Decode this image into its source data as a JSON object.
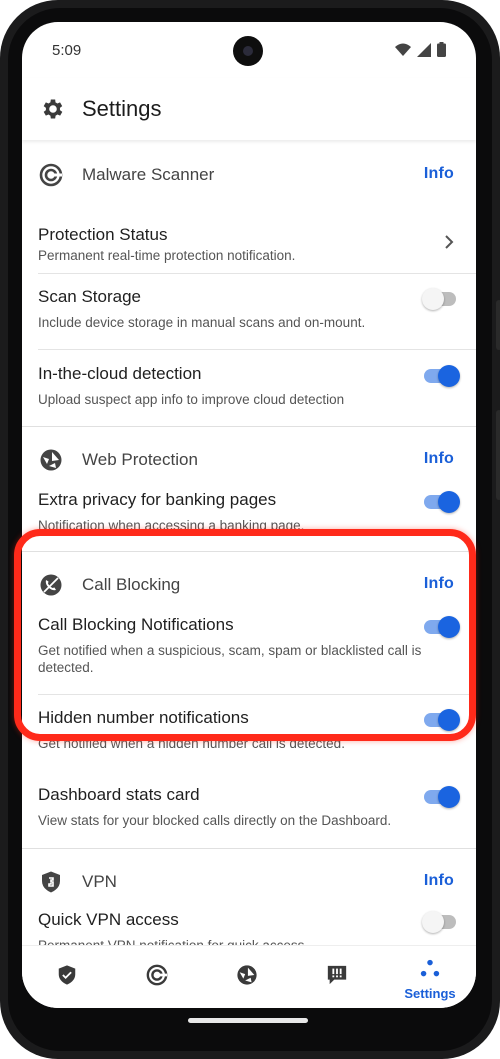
{
  "status": {
    "time": "5:09"
  },
  "app": {
    "title": "Settings"
  },
  "sections": [
    {
      "title": "Malware Scanner",
      "info": "Info",
      "icon": "malware-scanner-icon",
      "rows": [
        {
          "title": "Protection Status",
          "subtitle": "Permanent real-time protection notification.",
          "control": "chevron"
        },
        {
          "title": "Scan Storage",
          "subtitle": "Include device storage in manual scans and on-mount.",
          "control": "toggle",
          "on": false
        },
        {
          "title": "In-the-cloud detection",
          "subtitle": "Upload suspect app info to improve cloud detection",
          "control": "toggle",
          "on": true
        }
      ]
    },
    {
      "title": "Web Protection",
      "info": "Info",
      "icon": "web-protection-icon",
      "rows": [
        {
          "title": "Extra privacy for banking pages",
          "subtitle": "Notification when accessing a banking page.",
          "control": "toggle",
          "on": true
        }
      ]
    },
    {
      "title": "Call Blocking",
      "info": "Info",
      "icon": "call-blocking-icon",
      "rows": [
        {
          "title": "Call Blocking Notifications",
          "subtitle": "Get notified when a suspicious, scam, spam or blacklisted call is detected.",
          "control": "toggle",
          "on": true
        },
        {
          "title": "Hidden number notifications",
          "subtitle": "Get notified when a hidden number call is detected.",
          "control": "toggle",
          "on": true
        },
        {
          "title": "Dashboard stats card",
          "subtitle": "View stats for your blocked calls directly on the Dashboard.",
          "control": "toggle",
          "on": true
        }
      ]
    },
    {
      "title": "VPN",
      "info": "Info",
      "icon": "vpn-shield-icon",
      "rows": [
        {
          "title": "Quick VPN access",
          "subtitle": "Permanent VPN notification for quick access.",
          "control": "toggle",
          "on": false
        }
      ]
    }
  ],
  "bottom_nav": [
    {
      "icon": "shield-check-icon",
      "label": ""
    },
    {
      "icon": "scanner-icon",
      "label": ""
    },
    {
      "icon": "web-icon",
      "label": ""
    },
    {
      "icon": "message-alert-icon",
      "label": ""
    },
    {
      "icon": "settings-dots-icon",
      "label": "Settings",
      "active": true
    }
  ],
  "colors": {
    "accent": "#1a5fd8",
    "highlight": "#ff2a1a"
  }
}
